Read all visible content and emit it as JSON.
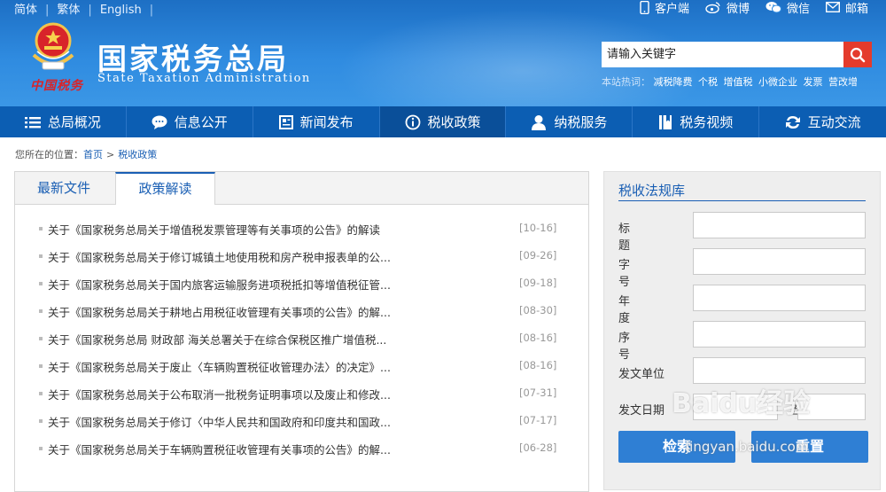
{
  "lang_links": [
    "简体",
    "繁体",
    "English"
  ],
  "top_links": [
    {
      "label": "客户端",
      "icon": "mobile-icon"
    },
    {
      "label": "微博",
      "icon": "weibo-icon"
    },
    {
      "label": "微信",
      "icon": "wechat-icon"
    },
    {
      "label": "邮箱",
      "icon": "mail-icon"
    }
  ],
  "site": {
    "title": "国家税务总局",
    "subtitle": "State Taxation Administration",
    "motto": "中国税务"
  },
  "search": {
    "placeholder": "请输入关键字"
  },
  "hot": {
    "label": "本站热词：",
    "words": [
      "减税降费",
      "个税",
      "增值税",
      "小微企业",
      "发票",
      "营改增"
    ]
  },
  "nav": [
    {
      "label": "总局概况",
      "icon": "menu-icon"
    },
    {
      "label": "信息公开",
      "icon": "chat-bubble-icon"
    },
    {
      "label": "新闻发布",
      "icon": "document-icon"
    },
    {
      "label": "税收政策",
      "icon": "info-icon"
    },
    {
      "label": "纳税服务",
      "icon": "user-icon"
    },
    {
      "label": "税务视频",
      "icon": "book-icon"
    },
    {
      "label": "互动交流",
      "icon": "exchange-icon"
    }
  ],
  "nav_active_index": 3,
  "breadcrumb": {
    "prefix": "您所在的位置：",
    "home": "首页",
    "sep": ">",
    "current": "税收政策"
  },
  "tabs": [
    "最新文件",
    "政策解读"
  ],
  "active_tab": 1,
  "news": [
    {
      "title": "关于《国家税务总局关于增值税发票管理等有关事项的公告》的解读",
      "date": "[10-16]"
    },
    {
      "title": "关于《国家税务总局关于修订城镇土地使用税和房产税申报表单的公...",
      "date": "[09-26]"
    },
    {
      "title": "关于《国家税务总局关于国内旅客运输服务进项税抵扣等增值税征管...",
      "date": "[09-18]"
    },
    {
      "title": "关于《国家税务总局关于耕地占用税征收管理有关事项的公告》的解...",
      "date": "[08-30]"
    },
    {
      "title": "关于《国家税务总局 财政部 海关总署关于在综合保税区推广增值税...",
      "date": "[08-16]"
    },
    {
      "title": "关于《国家税务总局关于废止〈车辆购置税征收管理办法〉的决定》...",
      "date": "[08-16]"
    },
    {
      "title": "关于《国家税务总局关于公布取消一批税务证明事项以及废止和修改...",
      "date": "[07-31]"
    },
    {
      "title": "关于《国家税务总局关于修订〈中华人民共和国政府和印度共和国政...",
      "date": "[07-17]"
    },
    {
      "title": "关于《国家税务总局关于车辆购置税征收管理有关事项的公告》的解...",
      "date": "[06-28]"
    }
  ],
  "law_panel": {
    "title": "税收法规库",
    "fields": [
      "标题",
      "字号",
      "年度",
      "序号",
      "发文单位"
    ],
    "date_label": "发文日期",
    "to_label": "至",
    "search_btn": "检索",
    "reset_btn": "重置"
  },
  "watermark": {
    "main": "Baidu经验",
    "sub": "jingyan.baidu.com"
  },
  "colors": {
    "header": "#2f8be0",
    "nav": "#0c5eb3",
    "nav_active": "#0a4f99",
    "search_button": "#e43b2c",
    "link": "#1a5fb4",
    "button": "#2f7fd4"
  }
}
